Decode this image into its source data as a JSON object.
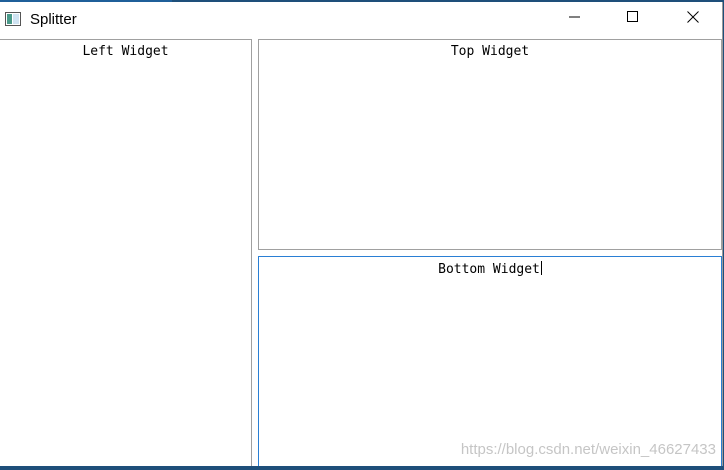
{
  "window": {
    "title": "Splitter",
    "icon": "window-app-icon",
    "controls": {
      "minimize": "minimize-icon",
      "maximize": "maximize-icon",
      "close": "close-icon"
    }
  },
  "splitter": {
    "left": {
      "label": "Left Widget"
    },
    "top": {
      "label": "Top Widget"
    },
    "bottom": {
      "label": "Bottom Widget"
    }
  },
  "watermark": "https://blog.csdn.net/weixin_46627433",
  "colors": {
    "focus_border": "#2a7fd4",
    "pane_border": "#a0a0a0",
    "desktop": "#1e4f7a"
  }
}
